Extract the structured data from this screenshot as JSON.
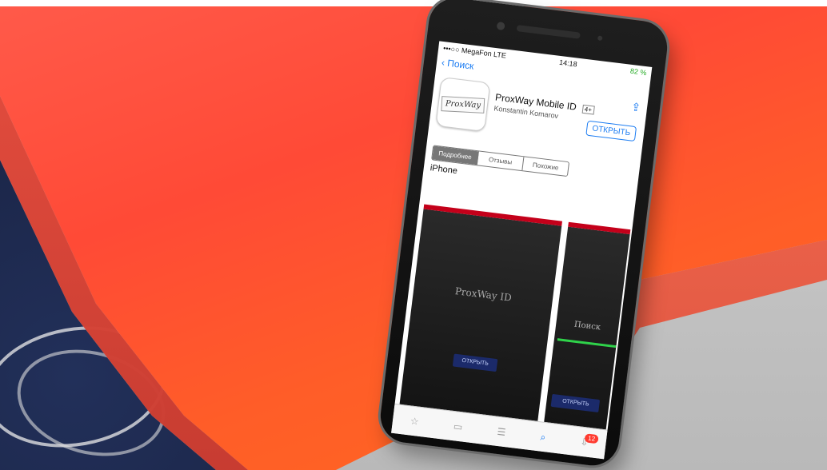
{
  "status": {
    "carrier": "•••○○ MegaFon  LTE",
    "time": "14:18",
    "battery": "82 %"
  },
  "nav": {
    "back_label": "Поиск"
  },
  "app": {
    "logo_text": "ProxWay",
    "title": "ProxWay Mobile ID",
    "rating": "4+",
    "developer": "Konstantin Komarov",
    "open_label": "ОТКРЫТЬ"
  },
  "segments": {
    "details": "Подробнее",
    "reviews": "Отзывы",
    "related": "Похожие"
  },
  "device_label": "iPhone",
  "screenshots": {
    "shot1_title": "ProxWay ID",
    "shot1_button": "ОТКРЫТЬ",
    "shot2_title": "Поиск",
    "shot2_button": "ОТКРЫТЬ"
  },
  "tabbar": {
    "updates_badge": "12"
  }
}
